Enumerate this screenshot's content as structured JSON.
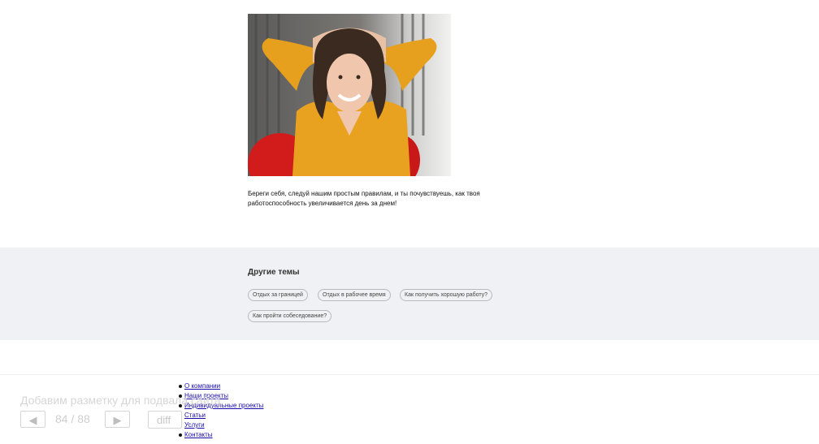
{
  "article": {
    "caption": "Береги себя, следуй нашим простым правилам, и ты почувствуешь, как твоя работоспособность увеличивается день за днем!"
  },
  "topics": {
    "title": "Другие темы",
    "chips": [
      "Отдых за границей",
      "Отдых в рабочее время",
      "Как получить хорошую работу?",
      "Как пройти собеседование?"
    ]
  },
  "footer": {
    "links": [
      "О компании",
      "Наши проекты",
      "Индивидуальные проекты",
      "Статьи",
      "Услуги",
      "Контакты"
    ]
  },
  "overlay": {
    "title": "Добавим разметку для подвала сайта",
    "prev_icon": "◀",
    "next_icon": "▶",
    "counter": "84 / 88",
    "diff_label": "diff"
  },
  "colors": {
    "topics_bg": "#f0f1f4",
    "link": "#1a0dab",
    "shirt": "#e8a21f",
    "chair": "#d21c1c"
  }
}
